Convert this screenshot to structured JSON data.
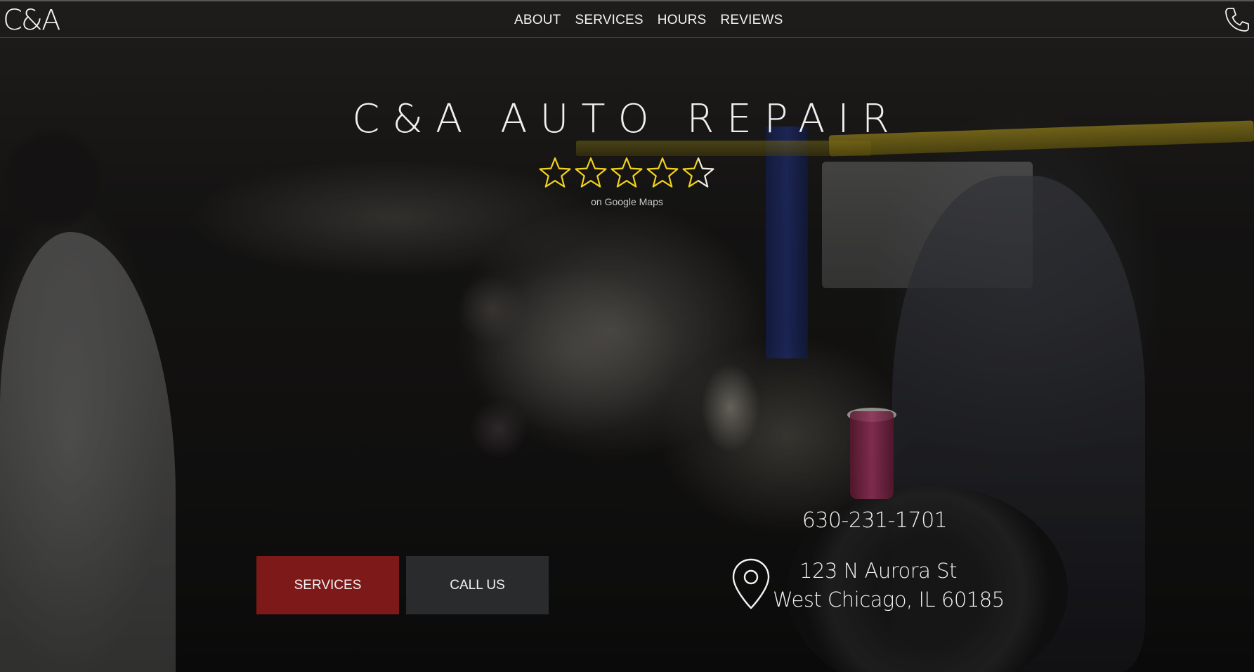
{
  "header": {
    "logo": "C&A",
    "nav": [
      {
        "label": "ABOUT"
      },
      {
        "label": "SERVICES"
      },
      {
        "label": "HOURS"
      },
      {
        "label": "REVIEWS"
      }
    ],
    "phone_icon": "phone-icon"
  },
  "hero": {
    "title": "C&A AUTO REPAIR",
    "rating": {
      "stars_filled": 4,
      "stars_total": 5,
      "star_color": "#f2d21a",
      "source": "on Google Maps"
    },
    "buttons": {
      "services": "SERVICES",
      "call": "CALL US"
    },
    "contact": {
      "phone": "630-231-1701",
      "address_line1": "123 N Aurora St",
      "address_line2": "West Chicago, IL 60185",
      "location_icon": "map-pin-icon"
    }
  },
  "colors": {
    "services_button": "#7d1a19",
    "call_button": "#2a2b2d",
    "text": "#f0f0f0"
  }
}
